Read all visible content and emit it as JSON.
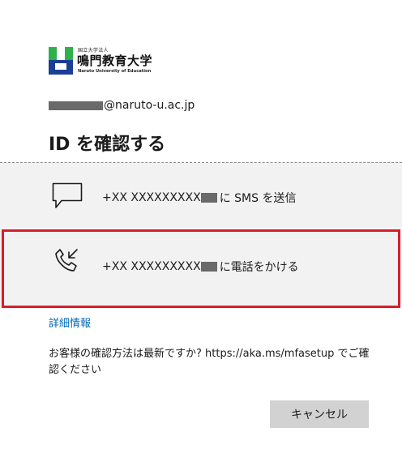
{
  "org": {
    "name_small": "国立大学法人",
    "name": "鳴門教育大学",
    "name_en": "Naruto University of Education"
  },
  "account": {
    "email_suffix": "@naruto-u.ac.jp"
  },
  "title": "ID を確認する",
  "options": [
    {
      "icon": "sms-icon",
      "number_prefix": "+XX XXXXXXXXX",
      "label": "に SMS を送信"
    },
    {
      "icon": "phone-call-icon",
      "number_prefix": "+XX XXXXXXXXX",
      "label": "に電話をかける"
    }
  ],
  "more_info": "詳細情報",
  "description": "お客様の確認方法は最新ですか? https://aka.ms/mfasetup でご確認ください",
  "buttons": {
    "cancel": "キャンセル"
  },
  "colors": {
    "highlight_border": "#d81e2c",
    "link": "#0067b8",
    "option_bg": "#f2f2f2"
  }
}
